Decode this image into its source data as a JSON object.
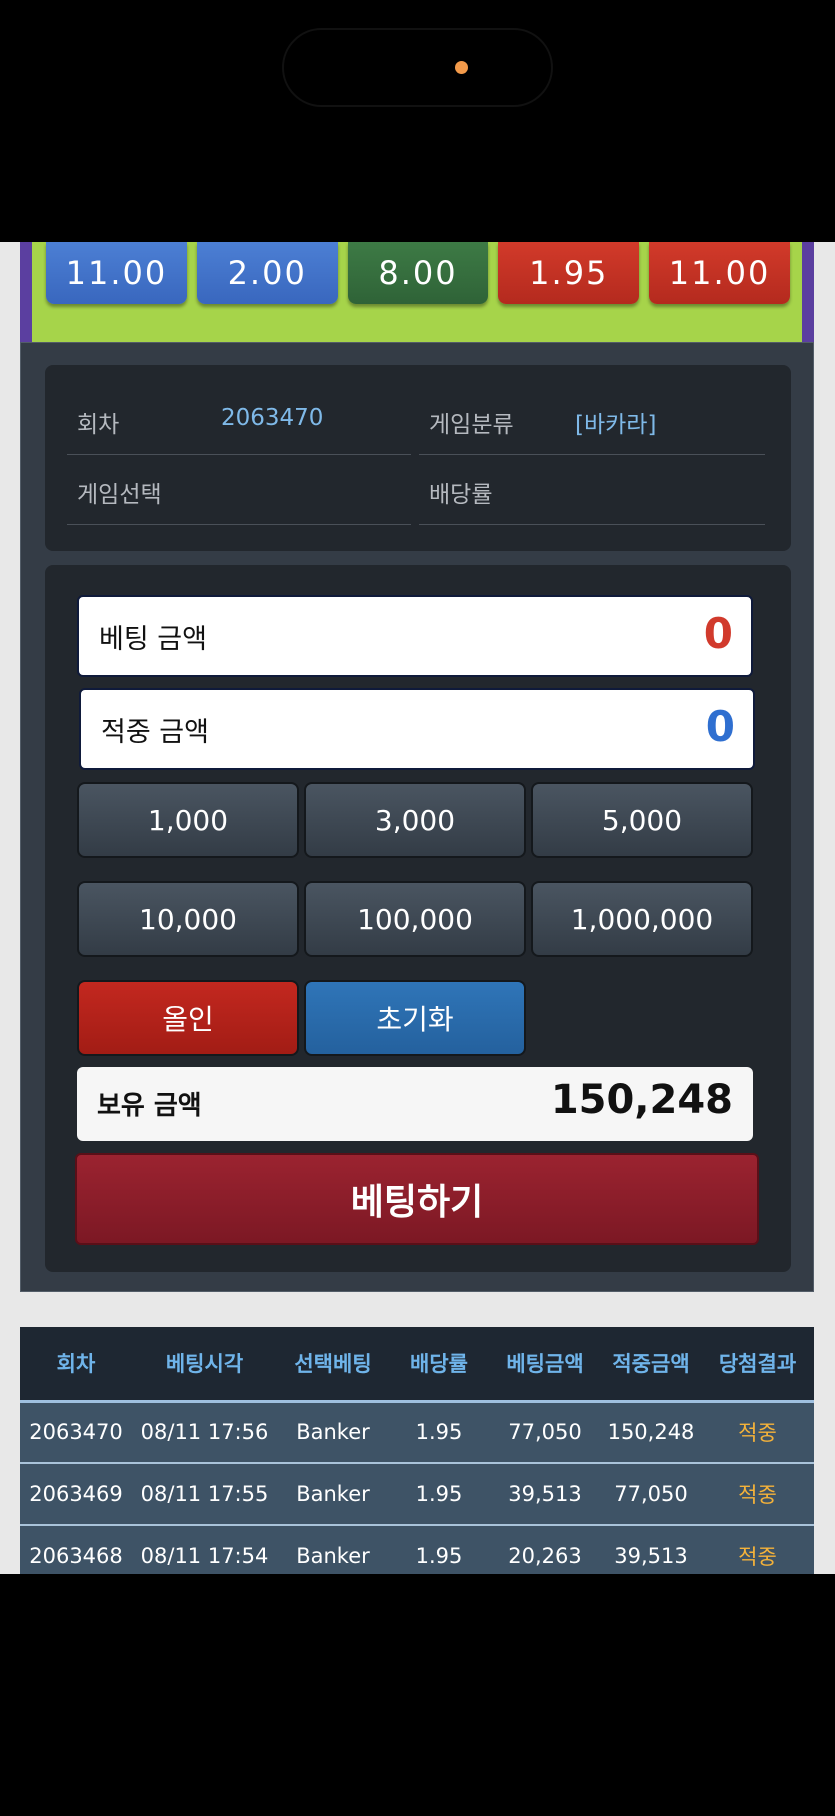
{
  "odds": [
    "11.00",
    "2.00",
    "8.00",
    "1.95",
    "11.00"
  ],
  "info": {
    "round_label": "회차",
    "round_value": "2063470",
    "category_label": "게임분류",
    "category_value": "[바카라]",
    "game_select_label": "게임선택",
    "game_select_value": "",
    "odds_label": "배당률",
    "odds_value": ""
  },
  "bet": {
    "bet_amount_label": "베팅 금액",
    "bet_amount_value": "0",
    "win_amount_label": "적중 금액",
    "win_amount_value": "0",
    "chips": [
      "1,000",
      "3,000",
      "5,000",
      "10,000",
      "100,000",
      "1,000,000"
    ],
    "allin_label": "올인",
    "reset_label": "초기화",
    "holding_label": "보유 금액",
    "holding_value": "150,248",
    "submit_label": "베팅하기"
  },
  "history": {
    "columns": [
      "회차",
      "베팅시각",
      "선택베팅",
      "배당률",
      "베팅금액",
      "적중금액",
      "당첨결과"
    ],
    "rows": [
      [
        "2063470",
        "08/11 17:56",
        "Banker",
        "1.95",
        "77,050",
        "150,248",
        "적중"
      ],
      [
        "2063469",
        "08/11 17:55",
        "Banker",
        "1.95",
        "39,513",
        "77,050",
        "적중"
      ],
      [
        "2063468",
        "08/11 17:54",
        "Banker",
        "1.95",
        "20,263",
        "39,513",
        "적중"
      ]
    ]
  },
  "colors": {
    "bet_amount": "#d13a2c",
    "win_amount": "#2f6fd0",
    "result": "#f4b23a"
  }
}
